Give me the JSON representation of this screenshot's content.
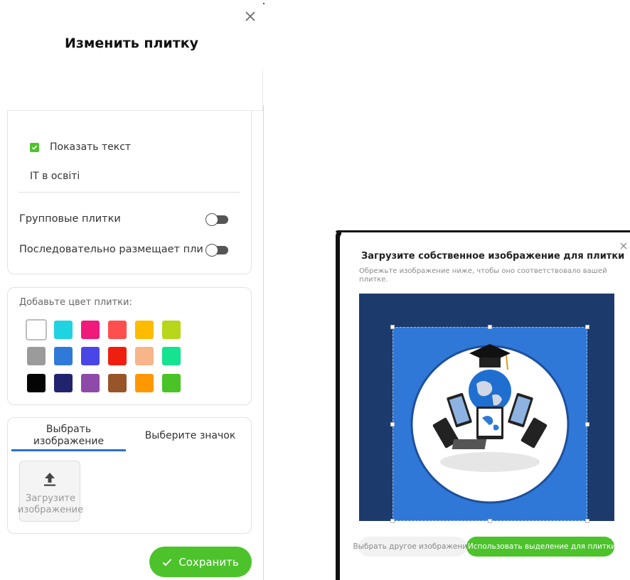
{
  "panel": {
    "title": "Изменить плитку",
    "show_text_label": "Показать текст",
    "show_text_checked": true,
    "tile_text": "IT в освіті",
    "group_tiles_label": "Групповые плитки",
    "sequential_label": "Последовательно размещает пли",
    "colors_label": "Добавьте цвет плитки:",
    "colors": [
      [
        "#ffffff",
        "#1fd3e0",
        "#ef1a7c",
        "#ff4e4e",
        "#ffbb00",
        "#b8d61a"
      ],
      [
        "#9b9b9b",
        "#2f7ad8",
        "#4a45e6",
        "#ef1f10",
        "#f7b58a",
        "#14e38f"
      ],
      [
        "#050505",
        "#22236e",
        "#8e4aa8",
        "#98552a",
        "#ff9800",
        "#49c326"
      ]
    ],
    "selected_color": "#ffffff",
    "tabs": [
      "Выбрать изображение",
      "Выберите значок"
    ],
    "active_tab": "Выбрать изображение",
    "upload_label": "Загрузите изображение",
    "save_label": "Сохранить",
    "accent": "#4cc32b",
    "tab_accent": "#2f6fd1"
  },
  "dialog": {
    "title": "Загрузите собственное изображение для плитки",
    "subtitle": "Обрежьте изображение ниже, чтобы оно соответствовало вашей плитке.",
    "other_image_label": "Выбрать другое изображение",
    "use_selection_label": "Использовать выделение для плитки",
    "crop_background": "#1c3a6b",
    "image_background": "#2f78d8"
  }
}
